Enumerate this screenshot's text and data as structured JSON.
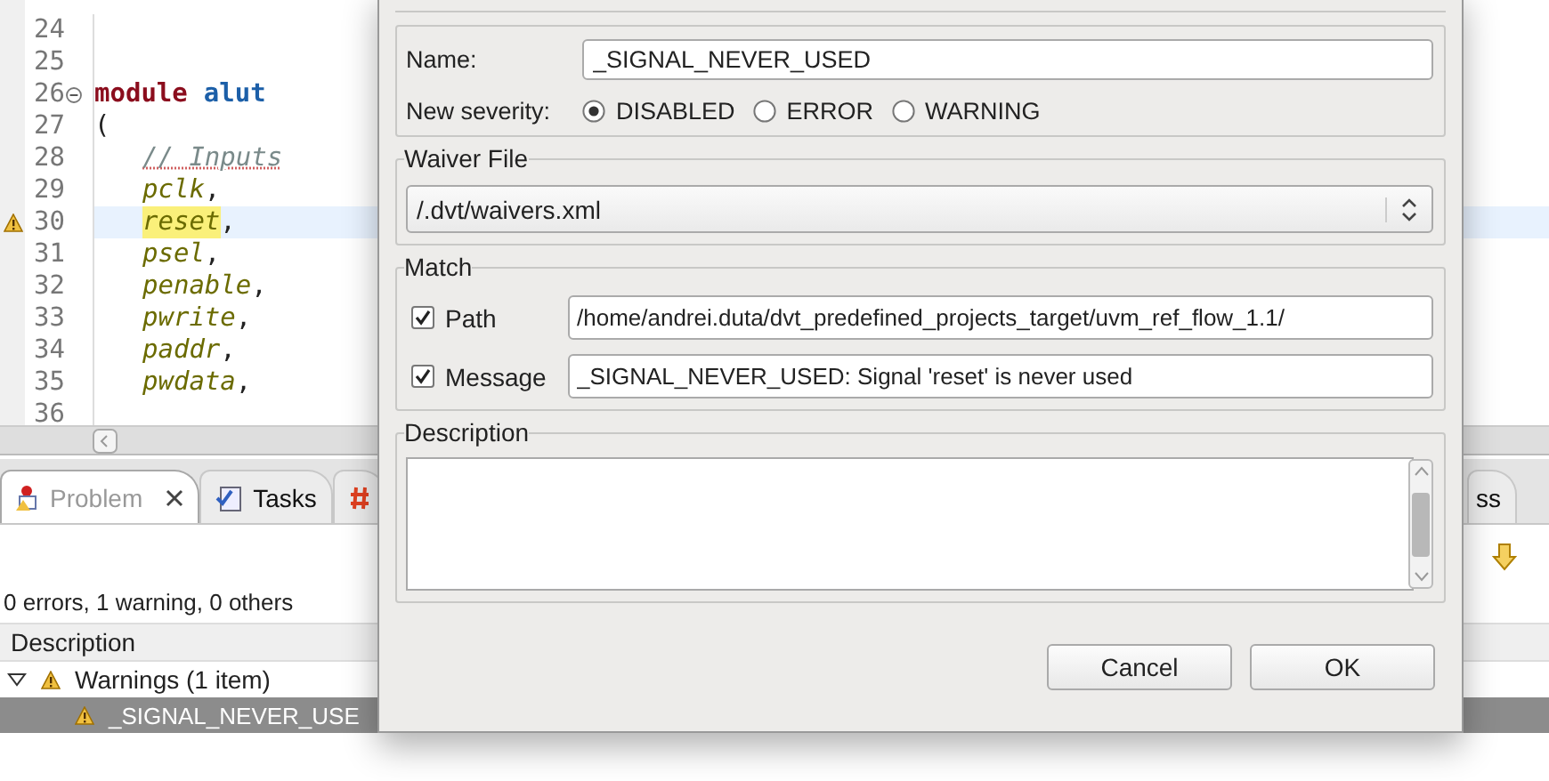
{
  "editor": {
    "lines": [
      {
        "number": "24"
      },
      {
        "number": "25"
      },
      {
        "number": "26",
        "foldable": true,
        "tokens": [
          {
            "kind": "keyword",
            "text": "module"
          },
          {
            "kind": "module-name",
            "text": "alut"
          }
        ]
      },
      {
        "number": "27",
        "tokens": [
          {
            "kind": "punct",
            "text": "("
          }
        ]
      },
      {
        "number": "28",
        "indented": true,
        "tokens": [
          {
            "kind": "comment",
            "text": "// Inputs"
          }
        ]
      },
      {
        "number": "29",
        "indented": true,
        "tokens": [
          {
            "kind": "identifier",
            "text": "pclk"
          },
          {
            "kind": "punct",
            "text": ","
          }
        ]
      },
      {
        "number": "30",
        "indented": true,
        "warning": true,
        "current": true,
        "tokens": [
          {
            "kind": "identifier",
            "text": "reset",
            "highlighted": true
          },
          {
            "kind": "punct",
            "text": ","
          }
        ]
      },
      {
        "number": "31",
        "indented": true,
        "tokens": [
          {
            "kind": "identifier",
            "text": "psel"
          },
          {
            "kind": "punct",
            "text": ","
          }
        ]
      },
      {
        "number": "32",
        "indented": true,
        "tokens": [
          {
            "kind": "identifier",
            "text": "penable"
          },
          {
            "kind": "punct",
            "text": ","
          }
        ]
      },
      {
        "number": "33",
        "indented": true,
        "tokens": [
          {
            "kind": "identifier",
            "text": "pwrite"
          },
          {
            "kind": "punct",
            "text": ","
          }
        ]
      },
      {
        "number": "34",
        "indented": true,
        "tokens": [
          {
            "kind": "identifier",
            "text": "paddr"
          },
          {
            "kind": "punct",
            "text": ","
          }
        ]
      },
      {
        "number": "35",
        "indented": true,
        "tokens": [
          {
            "kind": "identifier",
            "text": "pwdata"
          },
          {
            "kind": "punct",
            "text": ","
          }
        ]
      },
      {
        "number": "36"
      }
    ]
  },
  "panel": {
    "tabs": [
      {
        "kind": "problems",
        "label": "Problem",
        "selected": true,
        "closable": true
      },
      {
        "kind": "tasks",
        "label": "Tasks",
        "selected": false
      },
      {
        "kind": "hash",
        "selected": false
      },
      {
        "kind": "plain",
        "label": "ss",
        "selected": false
      }
    ],
    "summary": "0 errors, 1 warning, 0 others",
    "columns": [
      "Description"
    ],
    "tree": [
      {
        "label": "Warnings (1 item)",
        "expanded": true,
        "selected": false,
        "children": [
          {
            "label": "_SIGNAL_NEVER_USE",
            "selected": true
          }
        ]
      }
    ]
  },
  "dialog": {
    "name": {
      "label": "Name:",
      "value": "_SIGNAL_NEVER_USED"
    },
    "severity": {
      "label": "New severity:",
      "options": [
        {
          "label": "DISABLED",
          "selected": true
        },
        {
          "label": "ERROR",
          "selected": false
        },
        {
          "label": "WARNING",
          "selected": false
        }
      ]
    },
    "waiver_file": {
      "title": "Waiver File",
      "value": "/.dvt/waivers.xml"
    },
    "match": {
      "title": "Match",
      "items": [
        {
          "label": "Path",
          "checked": true,
          "value": "/home/andrei.duta/dvt_predefined_projects_target/uvm_ref_flow_1.1/"
        },
        {
          "label": "Message",
          "checked": true,
          "value": "_SIGNAL_NEVER_USED: Signal 'reset' is never used"
        }
      ]
    },
    "description": {
      "title": "Description"
    },
    "buttons": [
      "Cancel",
      "OK"
    ]
  }
}
